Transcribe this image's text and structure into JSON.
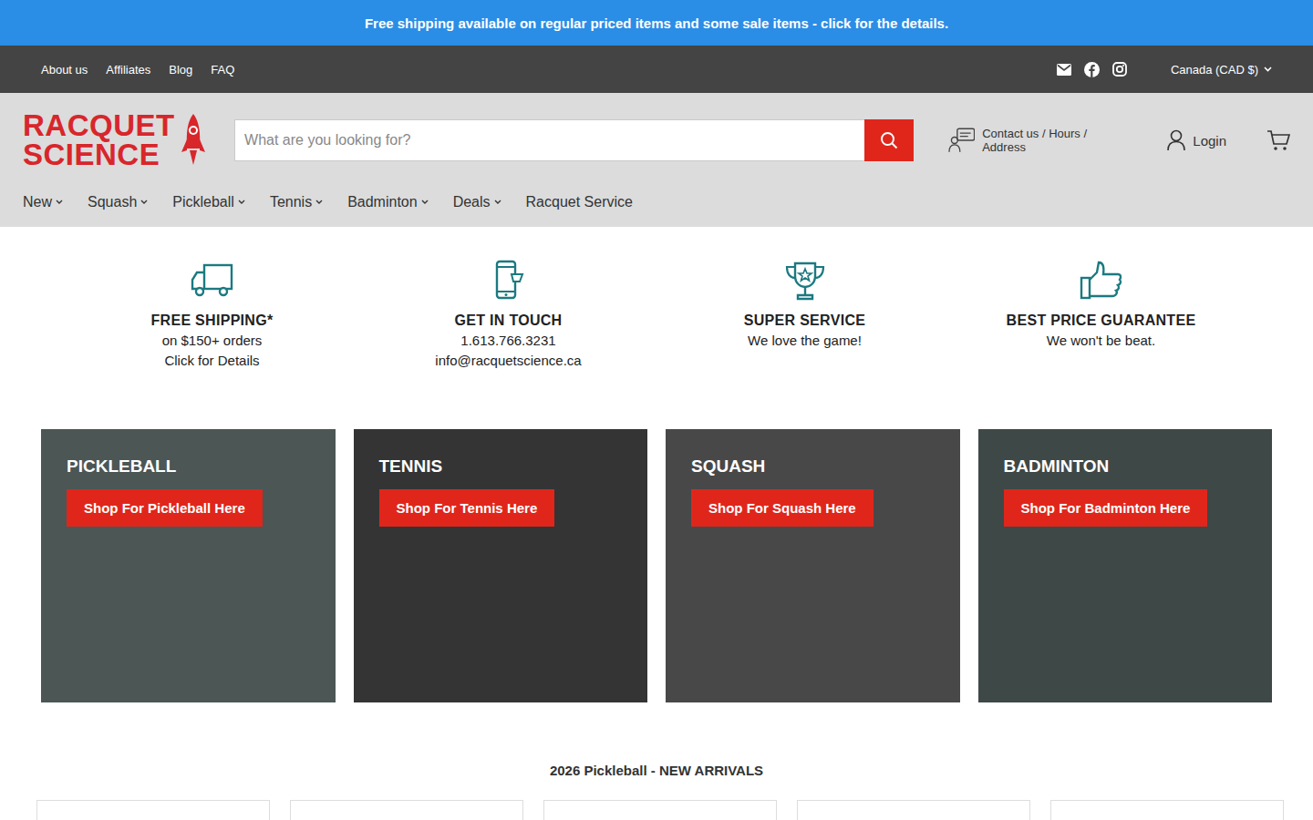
{
  "announcement": "Free shipping available on regular priced items and some sale items - click for the details.",
  "utility_nav": [
    "About us",
    "Affiliates",
    "Blog",
    "FAQ"
  ],
  "currency": "Canada (CAD $)",
  "logo": {
    "line1": "RACQUET",
    "line2": "SCIENCE"
  },
  "search": {
    "placeholder": "What are you looking for?"
  },
  "contact": "Contact us / Hours / Address",
  "login": "Login",
  "main_nav": [
    {
      "label": "New",
      "dropdown": true
    },
    {
      "label": "Squash",
      "dropdown": true
    },
    {
      "label": "Pickleball",
      "dropdown": true
    },
    {
      "label": "Tennis",
      "dropdown": true
    },
    {
      "label": "Badminton",
      "dropdown": true
    },
    {
      "label": "Deals",
      "dropdown": true
    },
    {
      "label": "Racquet Service",
      "dropdown": false
    }
  ],
  "features": [
    {
      "kind": "truck",
      "title": "FREE SHIPPING*",
      "lines": [
        "on $150+ orders",
        "Click for Details"
      ]
    },
    {
      "kind": "phone",
      "title": "GET IN TOUCH",
      "lines": [
        "1.613.766.3231",
        "info@racquetscience.ca"
      ]
    },
    {
      "kind": "trophy",
      "title": "SUPER SERVICE",
      "lines": [
        "We love the game!"
      ]
    },
    {
      "kind": "thumb",
      "title": "BEST PRICE GUARANTEE",
      "lines": [
        "We won't be beat."
      ]
    }
  ],
  "categories": [
    {
      "title": "PICKLEBALL",
      "button": "Shop For Pickleball Here"
    },
    {
      "title": "TENNIS",
      "button": "Shop For Tennis Here"
    },
    {
      "title": "SQUASH",
      "button": "Shop For Squash Here"
    },
    {
      "title": "BADMINTON",
      "button": "Shop For Badminton Here"
    }
  ],
  "new_arrivals": {
    "title": "2026 Pickleball - NEW ARRIVALS"
  }
}
